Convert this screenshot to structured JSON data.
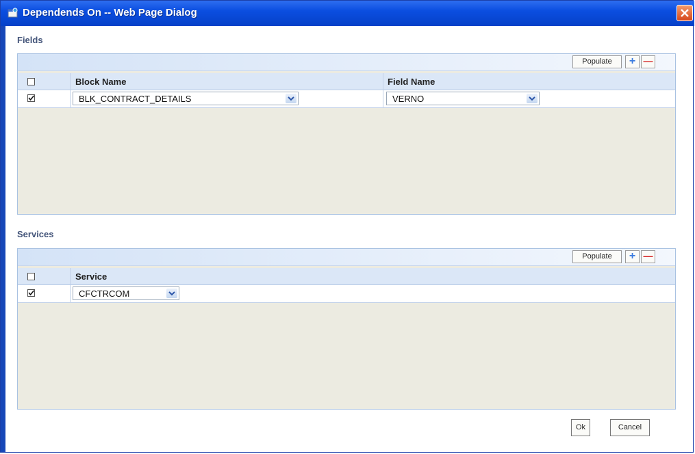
{
  "window": {
    "title": "Dependends On -- Web Page Dialog"
  },
  "fields_section": {
    "label": "Fields",
    "toolbar": {
      "populate_label": "Populate",
      "add_label": "+",
      "remove_label": "—"
    },
    "columns": [
      "Block Name",
      "Field Name"
    ],
    "rows": [
      {
        "checked": true,
        "block_name": "BLK_CONTRACT_DETAILS",
        "field_name": "VERNO"
      }
    ]
  },
  "services_section": {
    "label": "Services",
    "toolbar": {
      "populate_label": "Populate",
      "add_label": "+",
      "remove_label": "—"
    },
    "columns": [
      "Service"
    ],
    "rows": [
      {
        "checked": true,
        "service": "CFCTRCOM"
      }
    ]
  },
  "footer": {
    "ok_label": "Ok",
    "cancel_label": "Cancel"
  },
  "colors": {
    "titlebar": "#0b4ee0",
    "panel_bg": "#ecebe1",
    "header_bg": "#dbe7f7",
    "section_label": "#44557a"
  },
  "icons": {
    "title": "dialog-icon",
    "close": "close-icon",
    "dropdown": "chevron-down-icon"
  }
}
